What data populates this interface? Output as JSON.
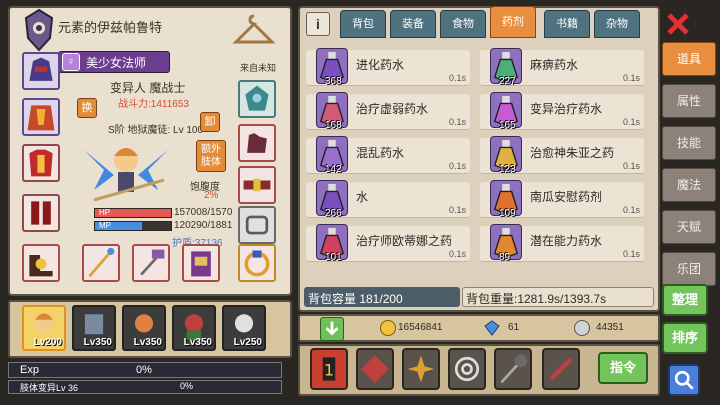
{
  "character": {
    "title": "元素的伊兹帕鲁特",
    "name": "美少女法师",
    "class": "变异人 魔战士",
    "power": "战斗力:1411653",
    "level": "S阶 地狱魔徒: Lv 100",
    "origin": "来自未知",
    "swap_label": "换",
    "unequip_label": "卸",
    "extra_body_label": "额外肢体",
    "satiety_label": "饱腹度",
    "satiety_value": "2%",
    "hp_label": "HP",
    "mp_label": "MP",
    "hp_text": "157008/1570",
    "mp_text": "120290/1881",
    "hp_ratio": 1.0,
    "mp_ratio": 0.62,
    "armor": "护盾:37136"
  },
  "party": [
    {
      "level": "Lv200",
      "active": true
    },
    {
      "level": "Lv350",
      "active": false
    },
    {
      "level": "Lv350",
      "active": false
    },
    {
      "level": "Lv350",
      "active": false
    },
    {
      "level": "Lv250",
      "active": false
    }
  ],
  "exp": {
    "label": "Exp",
    "value": "0%"
  },
  "body_mutation": {
    "label": "肢体变异Lv 36",
    "value": "0%"
  },
  "inventory": {
    "tabs": [
      {
        "label": "背包",
        "active": false
      },
      {
        "label": "装备",
        "active": false
      },
      {
        "label": "食物",
        "active": false
      },
      {
        "label": "药剂",
        "active": true
      },
      {
        "label": "书籍",
        "active": false
      },
      {
        "label": "杂物",
        "active": false
      }
    ],
    "items": [
      {
        "name": "进化药水",
        "count": "368",
        "weight": "0.1s",
        "color": "#7a4fc0"
      },
      {
        "name": "麻痹药水",
        "count": "227",
        "weight": "0.1s",
        "color": "#4fae7a"
      },
      {
        "name": "治疗虚弱药水",
        "count": "168",
        "weight": "0.1s",
        "color": "#d45a7c"
      },
      {
        "name": "变异治疗药水",
        "count": "165",
        "weight": "0.1s",
        "color": "#c85ad4"
      },
      {
        "name": "混乱药水",
        "count": "142",
        "weight": "0.1s",
        "color": "#9b6fd0"
      },
      {
        "name": "治愈神朱亚之药",
        "count": "123",
        "weight": "0.1s",
        "color": "#e0b040"
      },
      {
        "name": "水",
        "count": "266",
        "weight": "0.1s",
        "color": "#7a4fc0"
      },
      {
        "name": "南瓜安慰药剂",
        "count": "109",
        "weight": "0.1s",
        "color": "#e07030"
      },
      {
        "name": "治疗师欧蒂娜之药",
        "count": "101",
        "weight": "0.1s",
        "color": "#d04060"
      },
      {
        "name": "潜在能力药水",
        "count": "89",
        "weight": "0.1s",
        "color": "#e08830"
      }
    ],
    "capacity": "背包容量 181/200",
    "weight": "背包重量:1281.9s/1393.7s"
  },
  "currency": {
    "gold": "16546841",
    "gems": "61",
    "silver": "44351"
  },
  "nav": {
    "tabs": [
      "道具",
      "属性",
      "技能",
      "魔法",
      "天赋",
      "乐团"
    ],
    "sort_label": "整理",
    "order_label": "排序",
    "command_label": "指令"
  },
  "colors": {
    "accent": "#e88f3f",
    "panel": "#e9e0cf",
    "tab": "#4f7280",
    "green": "#72c45b"
  }
}
